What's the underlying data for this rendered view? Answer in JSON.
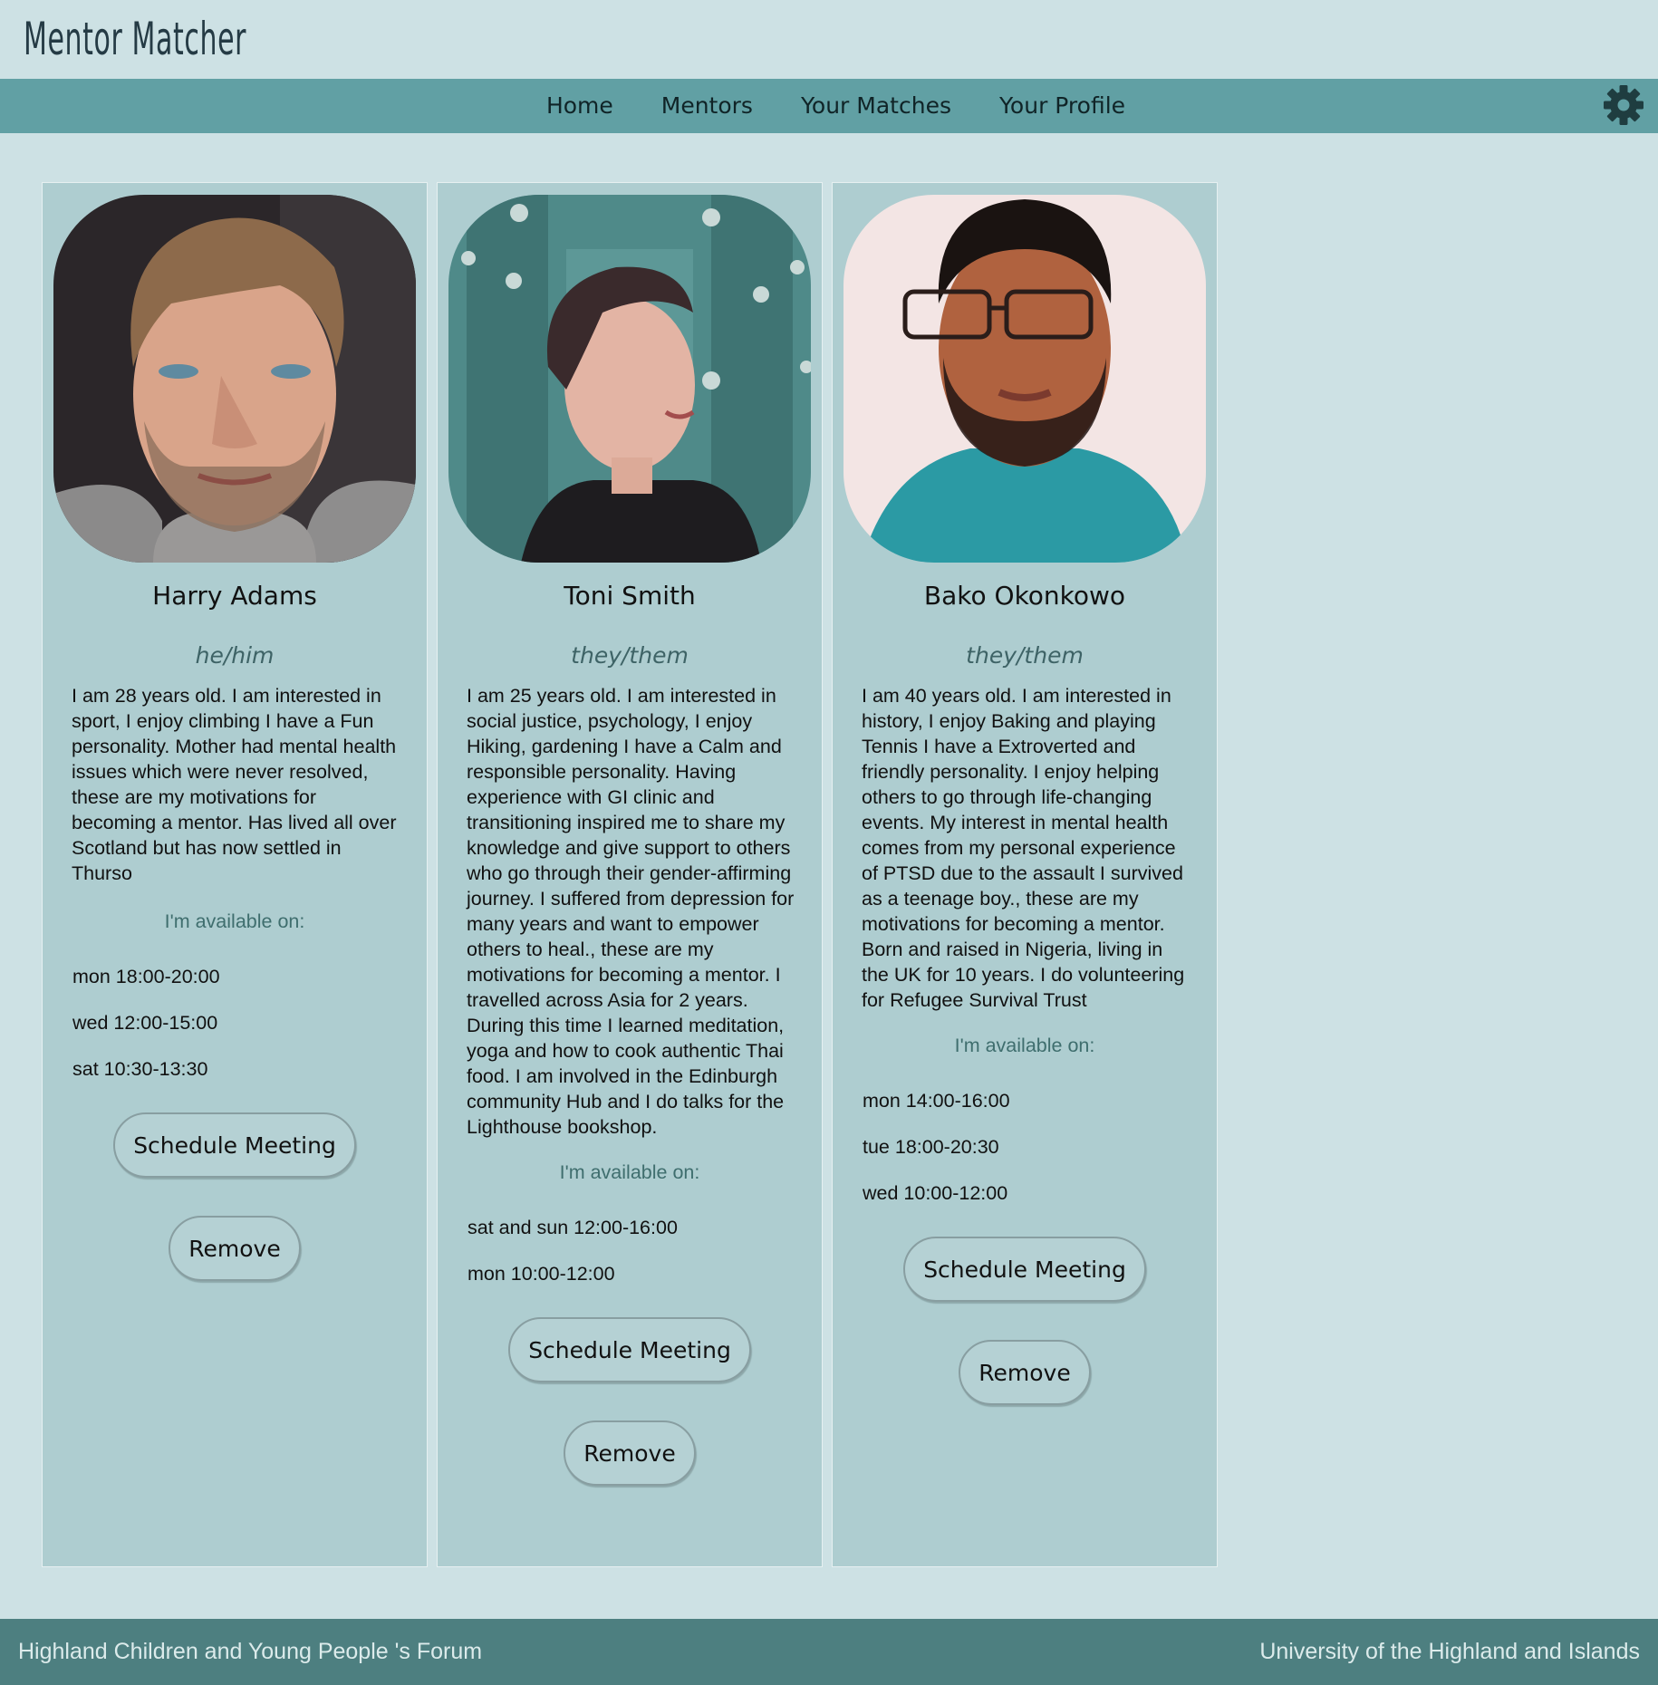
{
  "app": {
    "brand": "Mentor Matcher"
  },
  "nav": {
    "links": [
      "Home",
      "Mentors",
      "Your Matches",
      "Your Profile"
    ],
    "settings_icon": "gear-icon"
  },
  "colors": {
    "page_bg": "#cde1e4",
    "navbar": "#61a0a4",
    "card": "#aecdd0",
    "footer": "#4d7f80"
  },
  "mentors": [
    {
      "name": "Harry Adams",
      "pronouns": "he/him",
      "bio": "I am 28 years old. I am interested in sport, I enjoy climbing I have a Fun personality. Mother had mental health issues which were never resolved, these are my motivations for becoming a mentor. Has lived all over Scotland but has now settled in Thurso",
      "available_label": "I'm available on:",
      "availability": [
        "mon 18:00-20:00",
        "wed 12:00-15:00",
        "sat 10:30-13:30"
      ],
      "schedule_label": "Schedule Meeting",
      "remove_label": "Remove"
    },
    {
      "name": "Toni Smith",
      "pronouns": "they/them",
      "bio": "I am 25 years old. I am interested in social justice, psychology, I enjoy Hiking, gardening I have a Calm and responsible personality. Having experience with GI clinic and transitioning inspired me to share my knowledge and give support to others who go through their gender-affirming journey. I suffered from depression for many years and want to empower others to heal., these are my motivations for becoming a mentor. I travelled across Asia for 2 years. During this time I learned meditation, yoga and how to cook authentic Thai food. I am involved in the Edinburgh community Hub and I do talks for the Lighthouse bookshop.",
      "available_label": "I'm available on:",
      "availability": [
        "sat and sun 12:00-16:00",
        "mon 10:00-12:00"
      ],
      "schedule_label": "Schedule Meeting",
      "remove_label": "Remove"
    },
    {
      "name": "Bako Okonkowo",
      "pronouns": "they/them",
      "bio": "I am 40 years old. I am interested in history, I enjoy Baking and playing Tennis I have a Extroverted and friendly personality. I enjoy helping others to go through life-changing events. My interest in mental health comes from my personal experience of PTSD due to the assault I survived as a teenage boy., these are my motivations for becoming a mentor. Born and raised in Nigeria, living in the UK for 10 years. I do volunteering for Refugee Survival Trust",
      "available_label": "I'm available on:",
      "availability": [
        "mon 14:00-16:00",
        "tue 18:00-20:30",
        "wed 10:00-12:00"
      ],
      "schedule_label": "Schedule Meeting",
      "remove_label": "Remove"
    }
  ],
  "footer": {
    "left": "Highland Children and Young People 's Forum",
    "right": "University of the Highland and Islands"
  }
}
